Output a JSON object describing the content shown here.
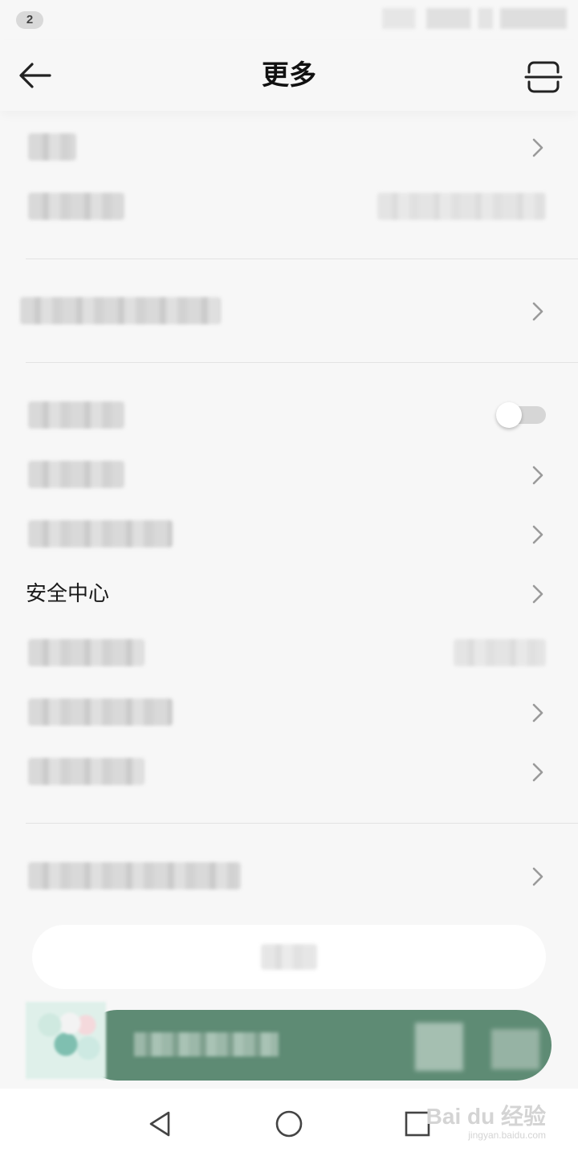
{
  "status_bar": {
    "notification_count": "2"
  },
  "header": {
    "title": "更多",
    "back_icon": "arrow-left-icon",
    "scan_icon": "scan-icon"
  },
  "rows": {
    "security_center": {
      "label": "安全中心"
    }
  },
  "colors": {
    "background": "#f7f7f7",
    "player_bar": "#5e8b74",
    "toggle_off": "#d6d6d6",
    "chevron": "#9a9a9a"
  },
  "settings": {
    "toggle_on": false
  },
  "watermark": {
    "line1": "Bai du 经验",
    "line2": "jingyan.baidu.com"
  }
}
